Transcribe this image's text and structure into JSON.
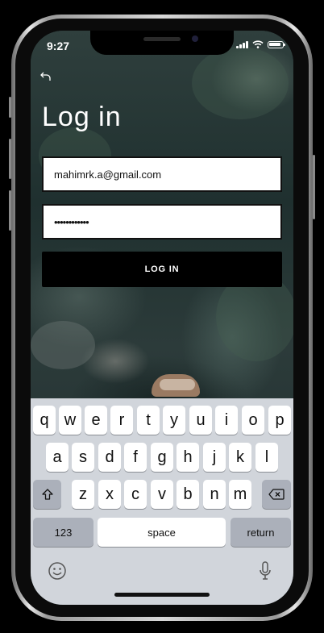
{
  "status_bar": {
    "time": "9:27"
  },
  "nav": {
    "back_icon": "undo-arrow-icon"
  },
  "page": {
    "title": "Log in"
  },
  "form": {
    "email_value": "mahimrk.a@gmail.com",
    "password_value": "••••••••••••",
    "login_label": "LOG IN"
  },
  "keyboard": {
    "row1": [
      "q",
      "w",
      "e",
      "r",
      "t",
      "y",
      "u",
      "i",
      "o",
      "p"
    ],
    "row2": [
      "a",
      "s",
      "d",
      "f",
      "g",
      "h",
      "j",
      "k",
      "l"
    ],
    "row3": [
      "z",
      "x",
      "c",
      "v",
      "b",
      "n",
      "m"
    ],
    "numbers_label": "123",
    "space_label": "space",
    "return_label": "return",
    "icons": [
      "shift-icon",
      "delete-icon",
      "emoji-icon",
      "microphone-icon"
    ]
  },
  "colors": {
    "button_bg": "#000000",
    "keyboard_bg": "#d1d5db"
  }
}
